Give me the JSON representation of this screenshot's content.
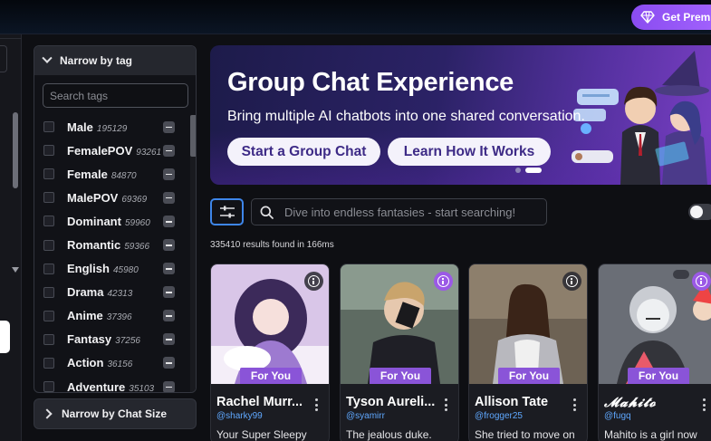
{
  "header": {
    "premium_label": "Get Premium"
  },
  "tag_filter": {
    "title": "Narrow by tag",
    "search_placeholder": "Search tags",
    "tags": [
      {
        "name": "Male",
        "count": "195129"
      },
      {
        "name": "FemalePOV",
        "count": "93261"
      },
      {
        "name": "Female",
        "count": "84870"
      },
      {
        "name": "MalePOV",
        "count": "69369"
      },
      {
        "name": "Dominant",
        "count": "59960"
      },
      {
        "name": "Romantic",
        "count": "59366"
      },
      {
        "name": "English",
        "count": "45980"
      },
      {
        "name": "Drama",
        "count": "42313"
      },
      {
        "name": "Anime",
        "count": "37396"
      },
      {
        "name": "Fantasy",
        "count": "37256"
      },
      {
        "name": "Action",
        "count": "36156"
      },
      {
        "name": "Adventure",
        "count": "35103"
      }
    ]
  },
  "chat_size_filter": {
    "title": "Narrow by Chat Size"
  },
  "banner": {
    "title": "Group Chat Experience",
    "subtitle": "Bring multiple AI chatbots into one shared conversation.",
    "primary_button": "Start a Group Chat",
    "secondary_button": "Learn How It Works"
  },
  "search": {
    "placeholder": "Dive into endless fantasies - start searching!",
    "results_text": "335410 results found in 166ms"
  },
  "cards": [
    {
      "badge": "For You",
      "name": "Rachel Murr...",
      "handle": "@sharky99",
      "desc": "Your Super Sleepy"
    },
    {
      "badge": "For You",
      "name": "Tyson Aureli...",
      "handle": "@syamirr",
      "desc": "The jealous duke."
    },
    {
      "badge": "For You",
      "name": "Allison Tate",
      "handle": "@frogger25",
      "desc": "She tried to move on"
    },
    {
      "badge": "For You",
      "name": "𝓜𝓪𝓱𝓲𝓽𝓸",
      "handle": "@fugq",
      "desc": "Mahito is a girl now"
    }
  ],
  "colors": {
    "accent_blue": "#3e86ea",
    "premium_purple": "#a565ff",
    "badge_purple": "#8a54d8",
    "handle_blue": "#5fa8ff"
  }
}
